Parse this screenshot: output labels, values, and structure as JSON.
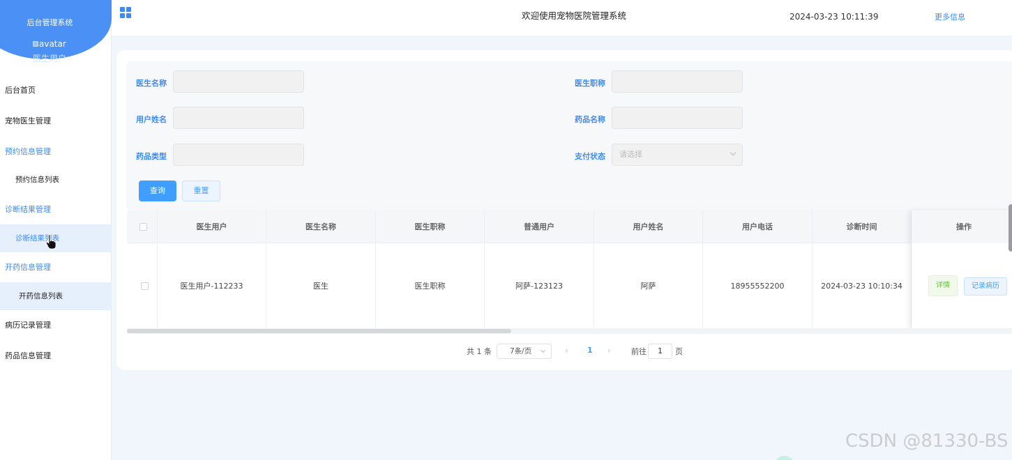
{
  "sidebar": {
    "brand_title": "后台管理系统",
    "avatar_alt": "avatar",
    "user_role": "医生用户",
    "items": [
      {
        "label": "后台首页"
      },
      {
        "label": "宠物医生管理"
      },
      {
        "label": "预约信息管理"
      },
      {
        "label": "预约信息列表"
      },
      {
        "label": "诊断结果管理"
      },
      {
        "label": "诊断结果列表"
      },
      {
        "label": "开药信息管理"
      },
      {
        "label": "开药信息列表"
      },
      {
        "label": "病历记录管理"
      },
      {
        "label": "药品信息管理"
      }
    ]
  },
  "header": {
    "title": "欢迎使用宠物医院管理系统",
    "datetime": "2024-03-23 10:11:39",
    "more": "更多信息"
  },
  "filters": {
    "doctor_name": "医生名称",
    "doctor_title": "医生职称",
    "user_name": "用户姓名",
    "drug_name": "药品名称",
    "drug_type": "药品类型",
    "pay_status": "支付状态",
    "pay_status_placeholder": "请选择",
    "query_button": "查询",
    "reset_button": "重置"
  },
  "table": {
    "columns": [
      "医生用户",
      "医生名称",
      "医生职称",
      "普通用户",
      "用户姓名",
      "用户电话",
      "诊断时间"
    ],
    "action_header": "操作",
    "rows": [
      {
        "cells": [
          "医生用户-112233",
          "医生",
          "医生职称",
          "阿萨-123123",
          "阿萨",
          "18955552200",
          "2024-03-23 10:10:34"
        ]
      }
    ],
    "detail_button": "详情",
    "record_button": "记录病历"
  },
  "pagination": {
    "total": "共 1 条",
    "page_size": "7条/页",
    "current_page": "1",
    "goto_label": "前往",
    "goto_value": "1",
    "page_suffix": "页"
  },
  "watermark": "CSDN @81330-BS",
  "colors": {
    "accent": "#409eff",
    "brand": "#4a90f5"
  }
}
